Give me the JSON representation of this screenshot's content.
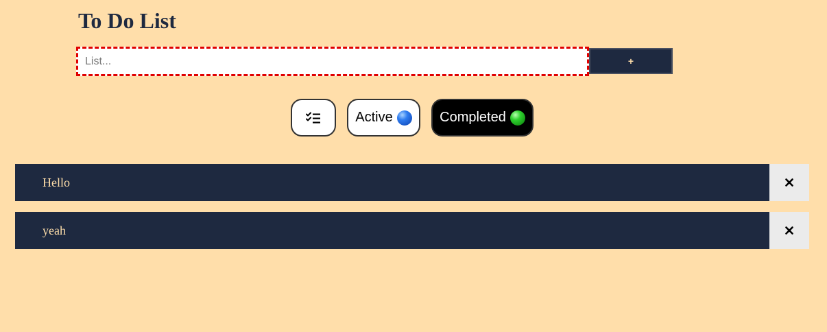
{
  "app": {
    "title": "To Do List"
  },
  "input": {
    "placeholder": "List...",
    "value": ""
  },
  "add_button": {
    "label": "+"
  },
  "filters": {
    "all": {
      "icon": "checklist-icon",
      "selected": false
    },
    "active": {
      "label": "Active",
      "icon": "blue-circle-icon",
      "selected": false
    },
    "completed": {
      "label": "Completed",
      "icon": "green-circle-icon",
      "selected": true
    }
  },
  "todos": [
    {
      "text": "Hello"
    },
    {
      "text": "yeah"
    }
  ],
  "delete_icon": "close-icon",
  "colors": {
    "background": "#ffdeaa",
    "primary": "#1e2940",
    "accent_text": "#ffdeaa",
    "delete_bg": "#ebebeb",
    "input_border": "#e00000"
  }
}
